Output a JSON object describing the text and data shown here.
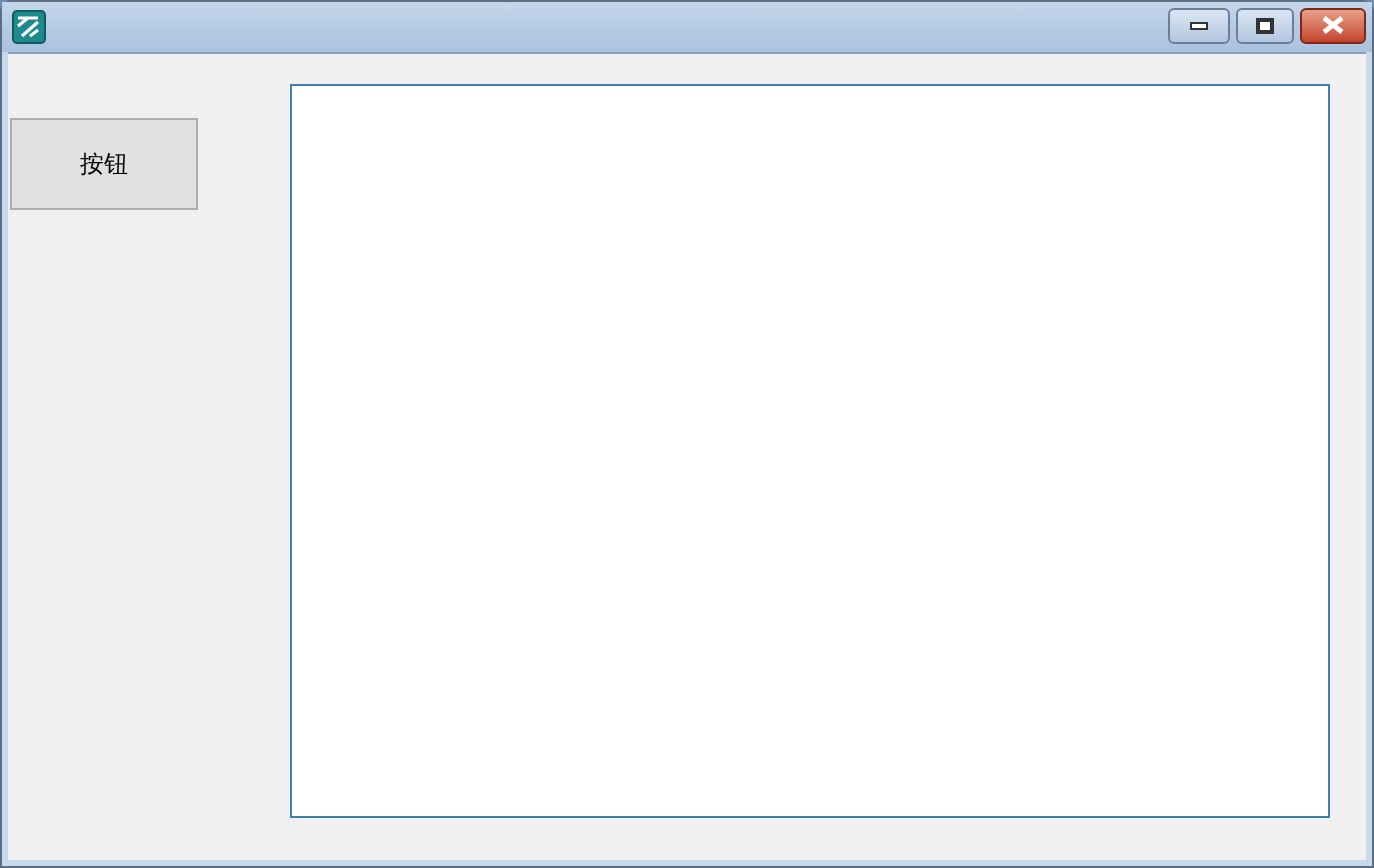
{
  "buttons": [
    {
      "label": "按钮"
    }
  ]
}
